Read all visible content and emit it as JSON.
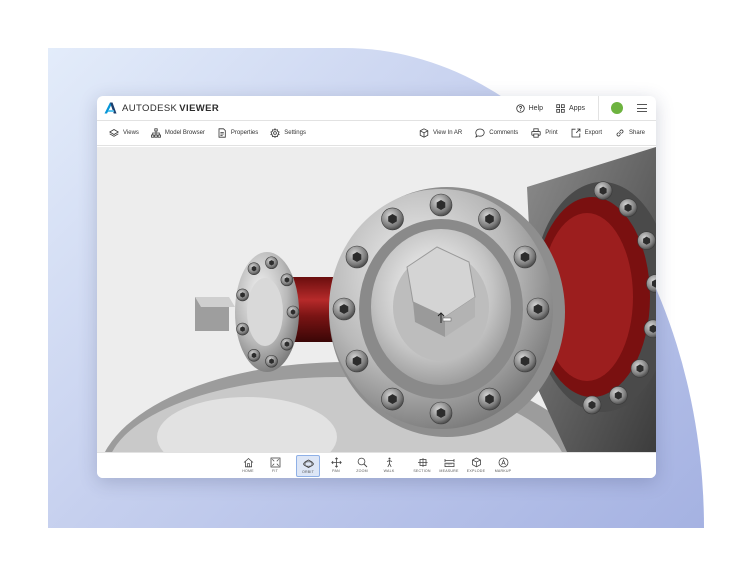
{
  "app": {
    "brand": "AUTODESK",
    "product": "VIEWER",
    "accent_color": "#0696d7",
    "user_status_color": "#6db33f"
  },
  "titlebar": {
    "help": {
      "label": "Help",
      "icon": "question-circle-icon"
    },
    "apps": {
      "label": "Apps",
      "icon": "grid-icon"
    },
    "menu_icon": "hamburger-menu-icon"
  },
  "toolbar": {
    "left": [
      {
        "label": "Views",
        "icon": "layers-icon"
      },
      {
        "label": "Model Browser",
        "icon": "hierarchy-icon"
      },
      {
        "label": "Properties",
        "icon": "document-icon"
      },
      {
        "label": "Settings",
        "icon": "gear-icon"
      }
    ],
    "right": [
      {
        "label": "View In AR",
        "icon": "ar-cube-icon"
      },
      {
        "label": "Comments",
        "icon": "speech-bubble-icon"
      },
      {
        "label": "Print",
        "icon": "printer-icon"
      },
      {
        "label": "Export",
        "icon": "export-icon"
      },
      {
        "label": "Share",
        "icon": "link-icon"
      }
    ]
  },
  "viewer": {
    "model": "flanged pipe assembly",
    "flange_color": "#8b1a1a"
  },
  "bottom_tools": [
    {
      "label": "HOME",
      "icon": "home-icon",
      "active": false
    },
    {
      "label": "FIT",
      "icon": "fit-icon",
      "active": false
    },
    {
      "label": "ORBIT",
      "icon": "orbit-icon",
      "active": true
    },
    {
      "label": "PAN",
      "icon": "pan-icon",
      "active": false
    },
    {
      "label": "ZOOM",
      "icon": "zoom-icon",
      "active": false
    },
    {
      "label": "WALK",
      "icon": "walk-icon",
      "active": false
    },
    {
      "label": "SECTION",
      "icon": "section-icon",
      "active": false
    },
    {
      "label": "MEASURE",
      "icon": "measure-icon",
      "active": false
    },
    {
      "label": "EXPLODE",
      "icon": "explode-icon",
      "active": false
    },
    {
      "label": "MARKUP",
      "icon": "markup-icon",
      "active": false
    }
  ]
}
